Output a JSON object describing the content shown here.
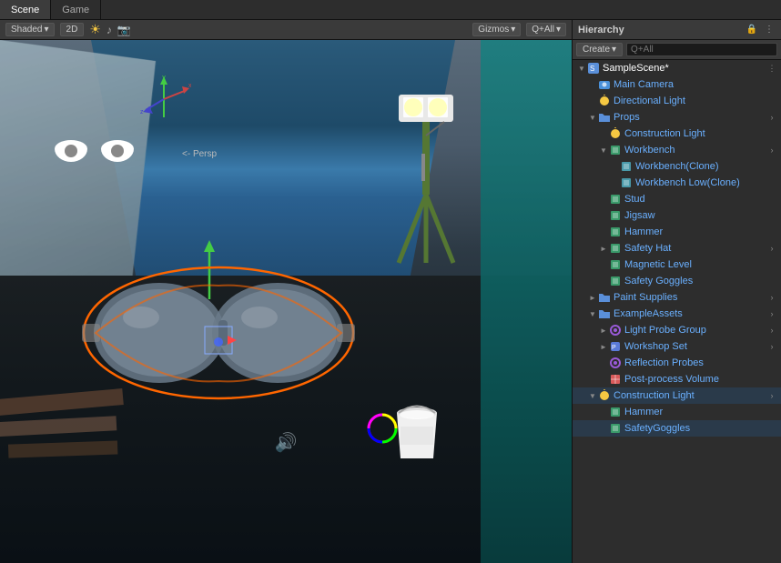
{
  "tabs": {
    "scene": "Scene",
    "game": "Game"
  },
  "viewport": {
    "shading": "Shaded",
    "mode_2d": "2D",
    "gizmos": "Gizmos",
    "all_label": "Q+All",
    "persp": "<- Persp"
  },
  "hierarchy": {
    "title": "Hierarchy",
    "create_btn": "Create",
    "all_btn": "All",
    "search_placeholder": "",
    "scene_name": "SampleScene*",
    "items": [
      {
        "id": "main-camera",
        "label": "Main Camera",
        "indent": 1,
        "icon": "camera",
        "arrow": "empty",
        "expand": false
      },
      {
        "id": "directional-light",
        "label": "Directional Light",
        "indent": 1,
        "icon": "light",
        "arrow": "empty",
        "expand": false
      },
      {
        "id": "props",
        "label": "Props",
        "indent": 1,
        "icon": "folder",
        "arrow": "open",
        "expand": true
      },
      {
        "id": "construction-light-1",
        "label": "Construction Light",
        "indent": 2,
        "icon": "light",
        "arrow": "empty",
        "expand": false
      },
      {
        "id": "workbench",
        "label": "Workbench",
        "indent": 2,
        "icon": "mesh",
        "arrow": "open",
        "expand": true
      },
      {
        "id": "workbench-clone",
        "label": "Workbench(Clone)",
        "indent": 3,
        "icon": "mesh-blue",
        "arrow": "empty",
        "expand": false
      },
      {
        "id": "workbench-low-clone",
        "label": "Workbench Low(Clone)",
        "indent": 3,
        "icon": "mesh-blue",
        "arrow": "empty",
        "expand": false
      },
      {
        "id": "stud",
        "label": "Stud",
        "indent": 2,
        "icon": "mesh",
        "arrow": "empty",
        "expand": false
      },
      {
        "id": "jigsaw",
        "label": "Jigsaw",
        "indent": 2,
        "icon": "mesh",
        "arrow": "empty",
        "expand": false
      },
      {
        "id": "hammer-1",
        "label": "Hammer",
        "indent": 2,
        "icon": "mesh",
        "arrow": "empty",
        "expand": false
      },
      {
        "id": "safety-hat",
        "label": "Safety Hat",
        "indent": 2,
        "icon": "mesh",
        "arrow": "closed",
        "expand": false
      },
      {
        "id": "magnetic-level",
        "label": "Magnetic Level",
        "indent": 2,
        "icon": "mesh",
        "arrow": "empty",
        "expand": false
      },
      {
        "id": "safety-goggles",
        "label": "Safety Goggles",
        "indent": 2,
        "icon": "mesh",
        "arrow": "empty",
        "expand": false
      },
      {
        "id": "paint-supplies",
        "label": "Paint Supplies",
        "indent": 1,
        "icon": "folder",
        "arrow": "closed",
        "expand": false
      },
      {
        "id": "example-assets",
        "label": "ExampleAssets",
        "indent": 1,
        "icon": "folder",
        "arrow": "open",
        "expand": true
      },
      {
        "id": "light-probe-group",
        "label": "Light Probe Group",
        "indent": 2,
        "icon": "probe",
        "arrow": "closed",
        "expand": false
      },
      {
        "id": "workshop-set",
        "label": "Workshop Set",
        "indent": 2,
        "icon": "prefab",
        "arrow": "closed",
        "expand": false
      },
      {
        "id": "reflection-probes",
        "label": "Reflection Probes",
        "indent": 2,
        "icon": "probe",
        "arrow": "empty",
        "expand": false
      },
      {
        "id": "post-process-volume",
        "label": "Post-process Volume",
        "indent": 2,
        "icon": "volume",
        "arrow": "empty",
        "expand": false
      },
      {
        "id": "construction-light-2",
        "label": "Construction Light",
        "indent": 1,
        "icon": "light",
        "arrow": "open",
        "expand": true
      },
      {
        "id": "hammer-2",
        "label": "Hammer",
        "indent": 2,
        "icon": "mesh",
        "arrow": "empty",
        "expand": false
      },
      {
        "id": "safety-goggles-2",
        "label": "SafetyGoggles",
        "indent": 2,
        "icon": "mesh",
        "arrow": "empty",
        "expand": false
      }
    ]
  }
}
